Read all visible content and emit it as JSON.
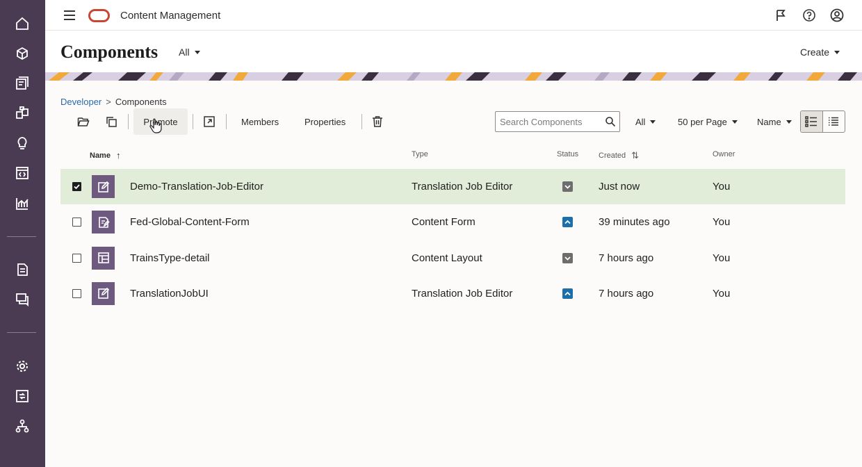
{
  "app": {
    "title": "Content Management"
  },
  "page": {
    "title": "Components",
    "filter_label": "All",
    "create_label": "Create"
  },
  "breadcrumb": {
    "parent": "Developer",
    "separator": ">",
    "current": "Components"
  },
  "toolbar": {
    "promote_label": "Promote",
    "members_label": "Members",
    "properties_label": "Properties",
    "search_placeholder": "Search Components",
    "type_filter": "All",
    "page_size": "50 per Page",
    "sort_by": "Name"
  },
  "table": {
    "columns": {
      "name": "Name",
      "type": "Type",
      "status": "Status",
      "created": "Created",
      "owner": "Owner"
    },
    "rows": [
      {
        "name": "Demo-Translation-Job-Editor",
        "type": "Translation Job Editor",
        "status": "draft",
        "created": "Just now",
        "owner": "You",
        "selected": true,
        "icon": "edit-icon"
      },
      {
        "name": "Fed-Global-Content-Form",
        "type": "Content Form",
        "status": "published",
        "created": "39 minutes ago",
        "owner": "You",
        "selected": false,
        "icon": "form-icon"
      },
      {
        "name": "TrainsType-detail",
        "type": "Content Layout",
        "status": "draft",
        "created": "7 hours ago",
        "owner": "You",
        "selected": false,
        "icon": "layout-icon"
      },
      {
        "name": "TranslationJobUI",
        "type": "Translation Job Editor",
        "status": "published",
        "created": "7 hours ago",
        "owner": "You",
        "selected": false,
        "icon": "edit-icon"
      }
    ]
  },
  "colors": {
    "rail": "#4a3a52",
    "selected_row": "#e1ecd9",
    "status_draft": "#6d6d6d",
    "status_published": "#1d6fa9",
    "thumb": "#6e5a7e",
    "oracle_red": "#c74634"
  }
}
